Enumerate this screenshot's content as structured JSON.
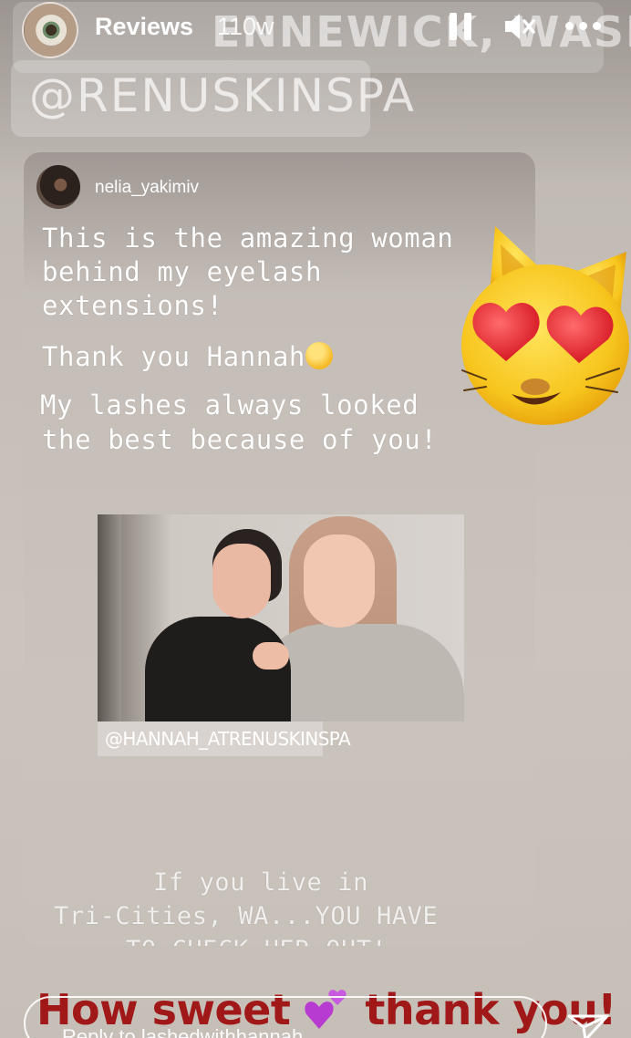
{
  "background": {
    "banner_text": "ENNEWICK, WASHINGTON",
    "account_text": "@RENUSKINSPA"
  },
  "header": {
    "title": "Reviews",
    "age": "110w",
    "icons": [
      "pause-icon",
      "mute-icon",
      "more-icon"
    ]
  },
  "card": {
    "username": "nelia_yakimiv",
    "lines": [
      "This is the amazing woman",
      "behind my eyelash",
      "extensions!",
      "Thank you Hannah",
      "My lashes always looked",
      "the best because of you!"
    ],
    "photo_tag": "@HANNAH_ATRENUSKINSPA",
    "cta": [
      "If you live in",
      "Tri-Cities, WA...YOU HAVE",
      "TO CHECK HER OUT!"
    ]
  },
  "footer": {
    "caption_left": "How sweet",
    "caption_right": "thank you!",
    "reply_placeholder": "Reply to lashedwithhannah"
  },
  "colors": {
    "caption": "#a01818",
    "accent_heart": "#b73bd1"
  }
}
